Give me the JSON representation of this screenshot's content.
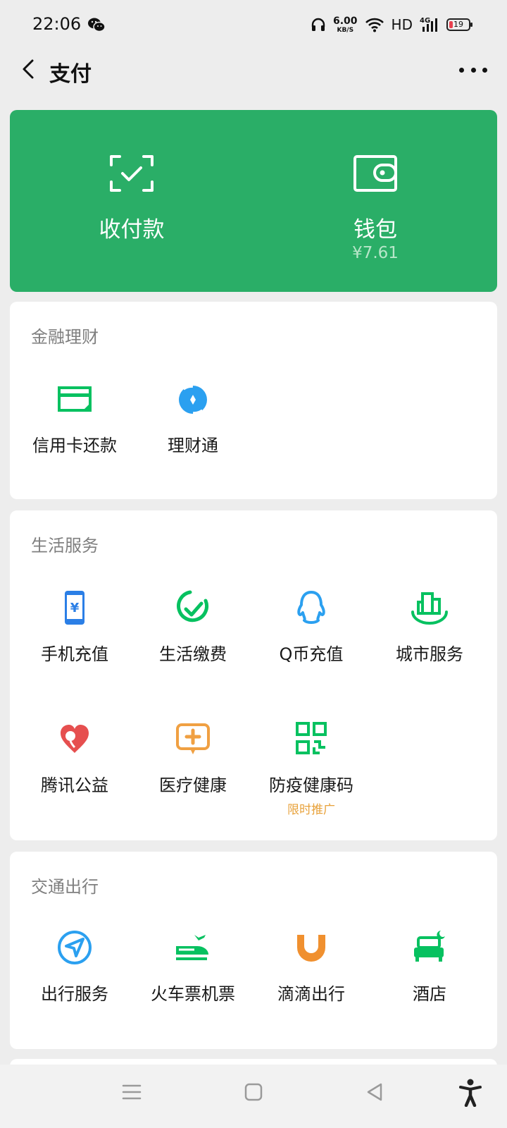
{
  "status": {
    "time": "22:06",
    "net_speed_value": "6.00",
    "net_speed_unit": "KB/S",
    "hd": "HD",
    "network": "4G",
    "battery": "19"
  },
  "nav": {
    "title": "支付"
  },
  "top_card": {
    "pay": {
      "label": "收付款",
      "icon": "scan-icon"
    },
    "wallet": {
      "label": "钱包",
      "balance": "¥7.61",
      "icon": "wallet-icon"
    }
  },
  "sections": {
    "finance": {
      "title": "金融理财",
      "items": [
        {
          "label": "信用卡还款",
          "icon": "credit-card-icon",
          "color": "#07c160"
        },
        {
          "label": "理财通",
          "icon": "wealth-icon",
          "color": "#2ba0f0"
        }
      ]
    },
    "life": {
      "title": "生活服务",
      "items": [
        {
          "label": "手机充值",
          "icon": "phone-topup-icon",
          "color": "#2b7fe6"
        },
        {
          "label": "生活缴费",
          "icon": "bill-pay-icon",
          "color": "#07c160"
        },
        {
          "label": "Q币充值",
          "icon": "qq-icon",
          "color": "#2ba0f0"
        },
        {
          "label": "城市服务",
          "icon": "city-icon",
          "color": "#07c160"
        },
        {
          "label": "腾讯公益",
          "icon": "charity-icon",
          "color": "#e64f4f"
        },
        {
          "label": "医疗健康",
          "icon": "medical-icon",
          "color": "#f0a042"
        },
        {
          "label": "防疫健康码",
          "icon": "qr-code-icon",
          "color": "#07c160",
          "promo": "限时推广"
        }
      ]
    },
    "travel": {
      "title": "交通出行",
      "items": [
        {
          "label": "出行服务",
          "icon": "navigation-icon",
          "color": "#2ba0f0"
        },
        {
          "label": "火车票机票",
          "icon": "train-plane-icon",
          "color": "#07c160"
        },
        {
          "label": "滴滴出行",
          "icon": "didi-icon",
          "color": "#f0902f"
        },
        {
          "label": "酒店",
          "icon": "hotel-icon",
          "color": "#07c160"
        }
      ]
    }
  }
}
